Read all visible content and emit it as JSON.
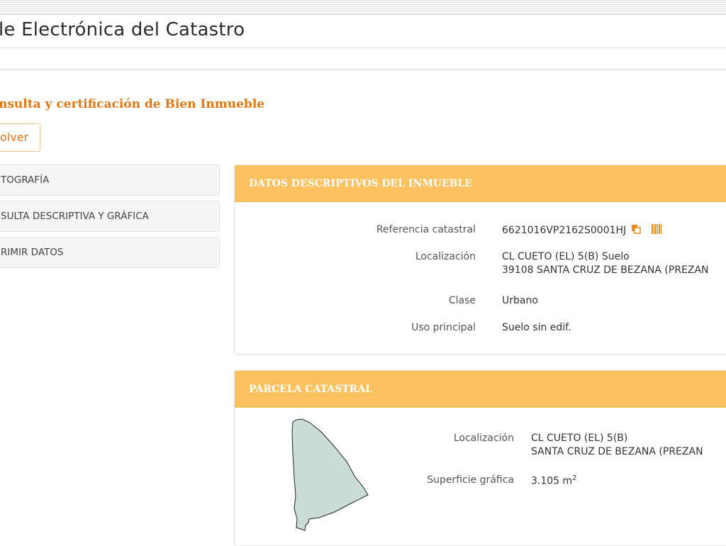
{
  "header": {
    "title": "le Electrónica del Catastro"
  },
  "page": {
    "title": "nsulta y certificación de Bien Inmueble",
    "back_label": "olver"
  },
  "sidebar": {
    "items": [
      {
        "label": "TOGRAFÍA"
      },
      {
        "label": "SULTA DESCRIPTIVA Y GRÁFICA"
      },
      {
        "label": "RIMIR DATOS"
      }
    ]
  },
  "descriptive": {
    "header": "DATOS DESCRIPTIVOS DEL INMUEBLE",
    "ref_label": "Referencia catastral",
    "ref_value": "6621016VP2162S0001HJ",
    "loc_label": "Localización",
    "loc_line1": "CL CUETO (EL) 5(B) Suelo",
    "loc_line2": "39108 SANTA CRUZ DE BEZANA (PREZAN",
    "class_label": "Clase",
    "class_value": "Urbano",
    "use_label": "Uso principal",
    "use_value": "Suelo sin edif."
  },
  "parcel": {
    "header": "PARCELA CATASTRAL",
    "loc_label": "Localización",
    "loc_line1": "CL CUETO (EL) 5(B)",
    "loc_line2": "SANTA CRUZ DE BEZANA (PREZAN",
    "area_label": "Superficie gráfica",
    "area_value": "3.105 m",
    "area_unit_sup": "2"
  },
  "icons": {
    "copy": "copy-icon",
    "barcode": "barcode-icon"
  },
  "colors": {
    "accent": "#e8760e",
    "panel_header": "#fbc15e",
    "parcel_fill": "#c9ddd6"
  }
}
